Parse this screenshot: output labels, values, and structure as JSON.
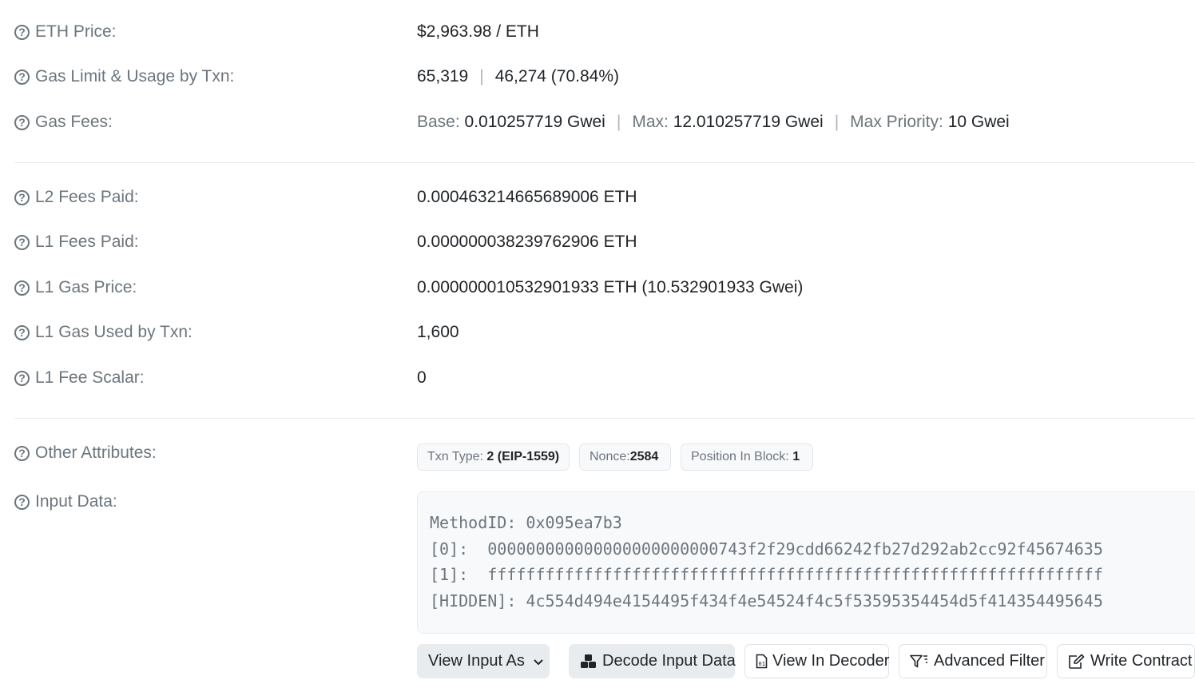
{
  "rows": {
    "eth_price": {
      "label": "ETH Price:",
      "value": "$2,963.98 / ETH"
    },
    "gas_limit": {
      "label": "Gas Limit & Usage by Txn:",
      "limit": "65,319",
      "sep": "|",
      "usage": "46,274 (70.84%)"
    },
    "gas_fees": {
      "label": "Gas Fees:",
      "base_label": "Base:",
      "base_value": "0.010257719 Gwei",
      "max_label": "Max:",
      "max_value": "12.010257719 Gwei",
      "priority_label": "Max Priority:",
      "priority_value": "10 Gwei",
      "sep": "|"
    },
    "l2_fees": {
      "label": "L2 Fees Paid:",
      "value": "0.000463214665689006 ETH"
    },
    "l1_fees": {
      "label": "L1 Fees Paid:",
      "value": "0.000000038239762906 ETH"
    },
    "l1_gas_price": {
      "label": "L1 Gas Price:",
      "value": "0.000000010532901933 ETH (10.532901933 Gwei)"
    },
    "l1_gas_used": {
      "label": "L1 Gas Used by Txn:",
      "value": "1,600"
    },
    "l1_fee_scalar": {
      "label": "L1 Fee Scalar:",
      "value": "0"
    },
    "other_attributes": {
      "label": "Other Attributes:",
      "txn_type_label": "Txn Type:",
      "txn_type_value": "2 (EIP-1559)",
      "nonce_label": "Nonce:",
      "nonce_value": "2584",
      "position_label": "Position In Block:",
      "position_value": "1"
    },
    "input_data": {
      "label": "Input Data:",
      "lines": [
        "MethodID: 0x095ea7b3",
        "[0]:  000000000000000000000000743f2f29cdd66242fb27d292ab2cc92f45674635",
        "[1]:  ffffffffffffffffffffffffffffffffffffffffffffffffffffffffffffffff",
        "[HIDDEN]: 4c554d494e4154495f434f4e54524f4c5f53595354454d5f414354495645"
      ]
    }
  },
  "buttons": {
    "view_input_as": "View Input As",
    "decode_input": "Decode Input Data",
    "view_in_decoder": "View In Decoder",
    "advanced_filter": "Advanced Filter",
    "write_contract": "Write Contract"
  },
  "icons": {
    "question": "question-circle-icon",
    "chevron": "chevron-down-icon",
    "cubes": "cubes-icon",
    "file_code": "file-code-icon",
    "filter": "filter-icon",
    "edit": "edit-icon"
  }
}
